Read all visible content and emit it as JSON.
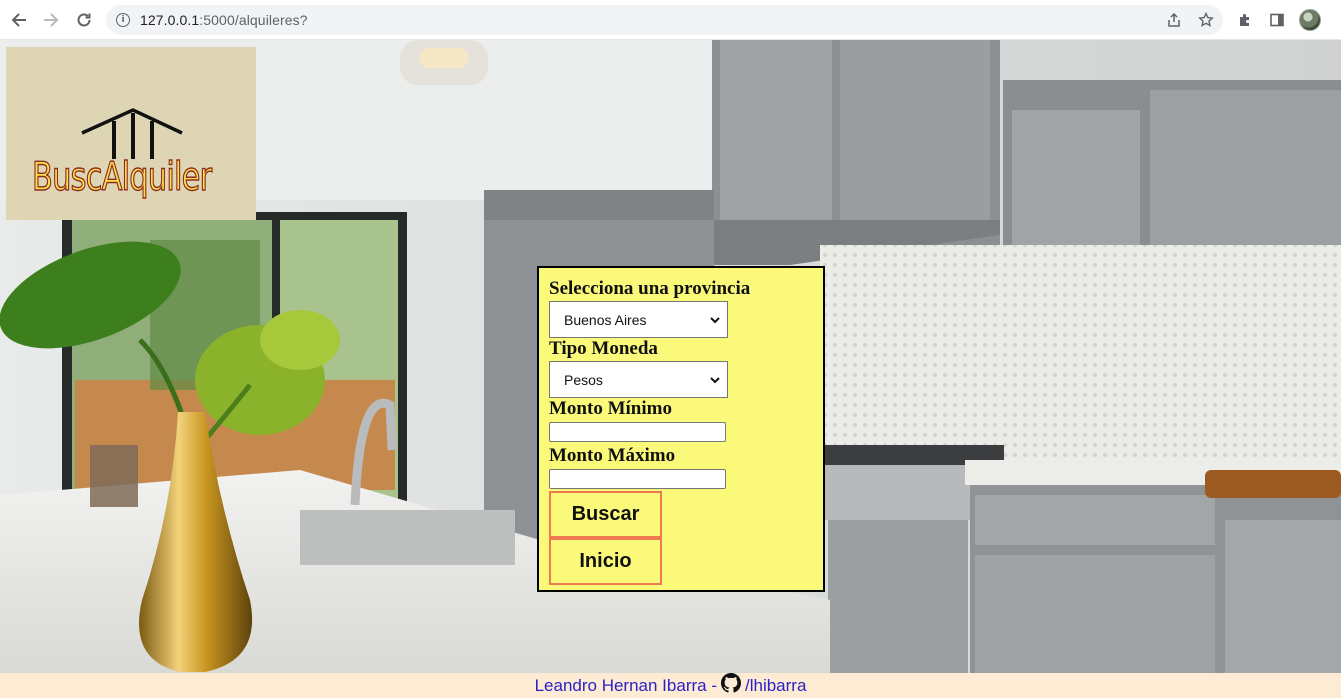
{
  "browser": {
    "url_host": "127.0.0.1",
    "url_rest": ":5000/alquileres?"
  },
  "logo": {
    "text": "BuscAlquiler"
  },
  "form": {
    "province_label": "Selecciona una provincia",
    "province_selected": "Buenos Aires",
    "currency_label": "Tipo Moneda",
    "currency_selected": "Pesos",
    "min_label": "Monto Mínimo",
    "min_value": "",
    "max_label": "Monto Máximo",
    "max_value": "",
    "search_button": "Buscar",
    "home_button": "Inicio"
  },
  "footer": {
    "author": "Leandro Hernan Ibarra -",
    "github_handle": "/lhibarra"
  },
  "colors": {
    "panel_bg": "#fbf97a",
    "button_border": "#f07a52",
    "logo_bg": "#ddd5b3",
    "footer_bg": "#fdebd3",
    "link": "#2a22c8"
  }
}
